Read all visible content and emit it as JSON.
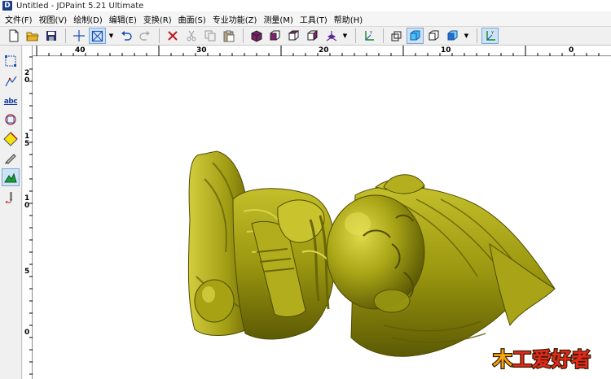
{
  "window": {
    "app_icon_letter": "D",
    "title": "Untitled - JDPaint 5.21 Ultimate"
  },
  "menu": [
    "文件(F)",
    "视图(V)",
    "绘制(D)",
    "编辑(E)",
    "变换(R)",
    "曲面(S)",
    "专业功能(Z)",
    "测量(M)",
    "工具(T)",
    "帮助(H)"
  ],
  "ruler": {
    "horizontal_labels": [
      "40",
      "30",
      "20",
      "10",
      "0"
    ],
    "vertical_labels": [
      "2\n0",
      "1\n5",
      "1\n0",
      "5",
      "0"
    ]
  },
  "watermark": {
    "text": "木工爱好者",
    "colors": {
      "wood": "#f2a713",
      "rest": "#e52a1c"
    }
  },
  "colors": {
    "model": "#9e9a12",
    "model_highlight": "#d2cc3c",
    "model_shadow": "#5f5c05",
    "active_tool": "#cfe3f7"
  }
}
